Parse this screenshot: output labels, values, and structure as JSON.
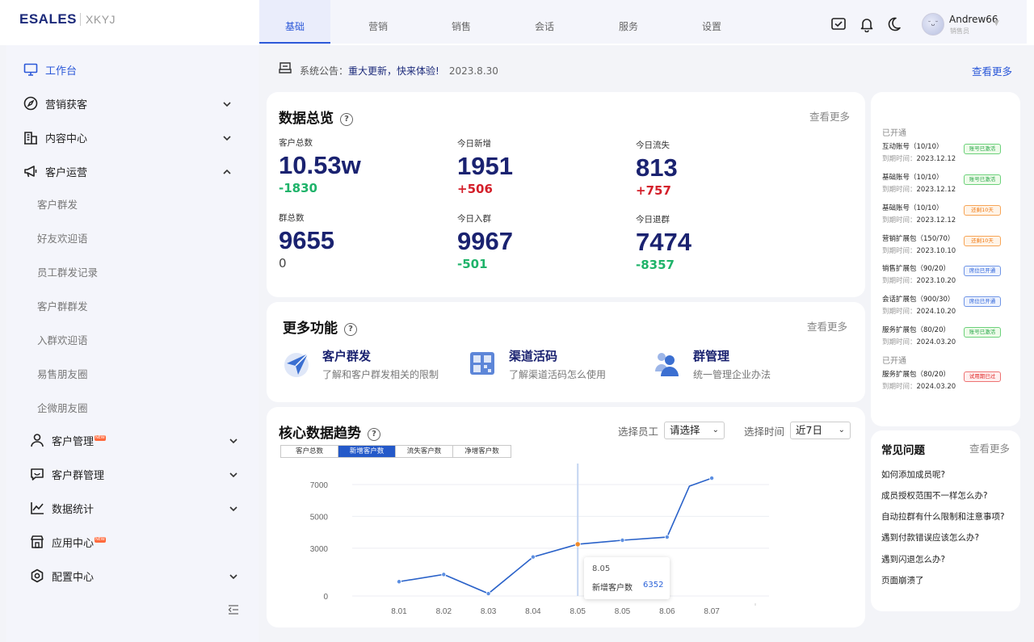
{
  "logo": {
    "brand": "ESALES",
    "sub": "XKYJ"
  },
  "topnav": {
    "tabs": [
      "基础",
      "营销",
      "销售",
      "会话",
      "服务",
      "设置"
    ],
    "active": 0
  },
  "user": {
    "name": "Andrew66",
    "role": "销售员",
    "avatar_text": "˘ᴗ˘"
  },
  "icons": {
    "tasks": "check-square-icon",
    "notify": "bell-icon",
    "theme": "moon-icon"
  },
  "sidebar": {
    "items": [
      {
        "label": "工作台",
        "icon": "monitor-icon",
        "active": true
      },
      {
        "label": "营销获客",
        "icon": "compass-icon"
      },
      {
        "label": "内容中心",
        "icon": "building-icon"
      },
      {
        "label": "客户运营",
        "icon": "megaphone-icon"
      },
      {
        "label": "客户管理",
        "icon": "user-icon",
        "badge": "NEW"
      },
      {
        "label": "客户群管理",
        "icon": "chat-icon"
      },
      {
        "label": "数据统计",
        "icon": "chart-icon"
      },
      {
        "label": "应用中心",
        "icon": "store-icon",
        "badge": "NEW"
      },
      {
        "label": "配置中心",
        "icon": "settings-icon"
      }
    ],
    "subitems": [
      "客户群发",
      "好友欢迎语",
      "员工群发记录",
      "客户群群发",
      "入群欢迎语",
      "易售朋友圈",
      "企微朋友圈"
    ]
  },
  "notice": {
    "label": "系统公告：",
    "text": "重大更新，快来体验!",
    "date": "2023.8.30",
    "more": "查看更多"
  },
  "overview": {
    "title": "数据总览",
    "more": "查看更多",
    "stats": [
      {
        "label": "客户总数",
        "value": "10.53w",
        "delta": "-1830",
        "trend": "neg"
      },
      {
        "label": "今日新增",
        "value": "1951",
        "delta": "+506",
        "trend": "pos"
      },
      {
        "label": "今日流失",
        "value": "813",
        "delta": "+757",
        "trend": "pos"
      },
      {
        "label": "群总数",
        "value": "9655",
        "delta": "0",
        "trend": "zero"
      },
      {
        "label": "今日入群",
        "value": "9967",
        "delta": "-501",
        "trend": "neg"
      },
      {
        "label": "今日退群",
        "value": "7474",
        "delta": "-8357",
        "trend": "neg"
      }
    ]
  },
  "functions": {
    "title": "更多功能",
    "more": "查看更多",
    "items": [
      {
        "name": "客户群发",
        "desc": "了解和客户群发相关的限制",
        "icon": "send-icon"
      },
      {
        "name": "渠道活码",
        "desc": "了解渠道活码怎么使用",
        "icon": "qrcode-icon"
      },
      {
        "name": "群管理",
        "desc": "统一管理企业办法",
        "icon": "group-icon"
      }
    ]
  },
  "trend": {
    "title": "核心数据趋势",
    "tabs": [
      "客户总数",
      "新增客户数",
      "流失客户数",
      "净增客户数"
    ],
    "active_tab": 1,
    "employee_label": "选择员工",
    "employee_value": "请选择",
    "time_label": "选择时间",
    "time_value": "近7日",
    "tooltip": {
      "date": "8.05",
      "label": "新增客户数",
      "value": "6352"
    }
  },
  "chart_data": {
    "type": "line",
    "categories": [
      "8.01",
      "8.02",
      "8.03",
      "8.04",
      "8.05",
      "8.05",
      "8.06",
      "8.07"
    ],
    "y_ticks": [
      "7000",
      "5000",
      "3000",
      "0"
    ],
    "series": [
      {
        "name": "新增客户数",
        "points": [
          [
            0,
            900
          ],
          [
            1,
            1350
          ],
          [
            2,
            150
          ],
          [
            3,
            2450
          ],
          [
            4,
            3250
          ],
          [
            5,
            3500
          ],
          [
            6,
            3700
          ],
          [
            6.5,
            6900
          ],
          [
            7,
            7400
          ]
        ]
      }
    ],
    "highlight_index": 4,
    "color": "#2f6fd6"
  },
  "accounts": {
    "head1": "已开通",
    "head2": "已开通",
    "items": [
      {
        "name": "互动账号（10/10）",
        "exp_label": "到期时间：",
        "exp": "2023.12.12",
        "status": "账号已激活",
        "color": "green"
      },
      {
        "name": "基础账号（10/10）",
        "exp_label": "到期时间：",
        "exp": "2023.12.12",
        "status": "账号已激活",
        "color": "green"
      },
      {
        "name": "基础账号（10/10）",
        "exp_label": "到期时间：",
        "exp": "2023.12.12",
        "status": "还剩10天",
        "color": "orange"
      },
      {
        "name": "营销扩展包（150/70）",
        "exp_label": "到期时间：",
        "exp": "2023.10.10",
        "status": "还剩10天",
        "color": "orange"
      },
      {
        "name": "销售扩展包（90/20）",
        "exp_label": "到期时间：",
        "exp": "2023.10.20",
        "status": "席位已开通",
        "color": "blue"
      },
      {
        "name": "会话扩展包（900/30）",
        "exp_label": "到期时间：",
        "exp": "2024.10.20",
        "status": "席位已开通",
        "color": "blue"
      },
      {
        "name": "服务扩展包（80/20）",
        "exp_label": "到期时间：",
        "exp": "2024.03.20",
        "status": "账号已激活",
        "color": "green"
      },
      {
        "name": "服务扩展包（80/20）",
        "exp_label": "到期时间：",
        "exp": "2024.03.20",
        "status": "试用期已过",
        "color": "red"
      }
    ]
  },
  "faq": {
    "title": "常见问题",
    "more": "查看更多",
    "items": [
      "如何添加成员呢?",
      "成员授权范围不一样怎么办?",
      "自动拉群有什么限制和注意事项?",
      "遇到付款错误应该怎么办?",
      "遇到闪退怎么办?",
      "页面崩溃了"
    ]
  }
}
